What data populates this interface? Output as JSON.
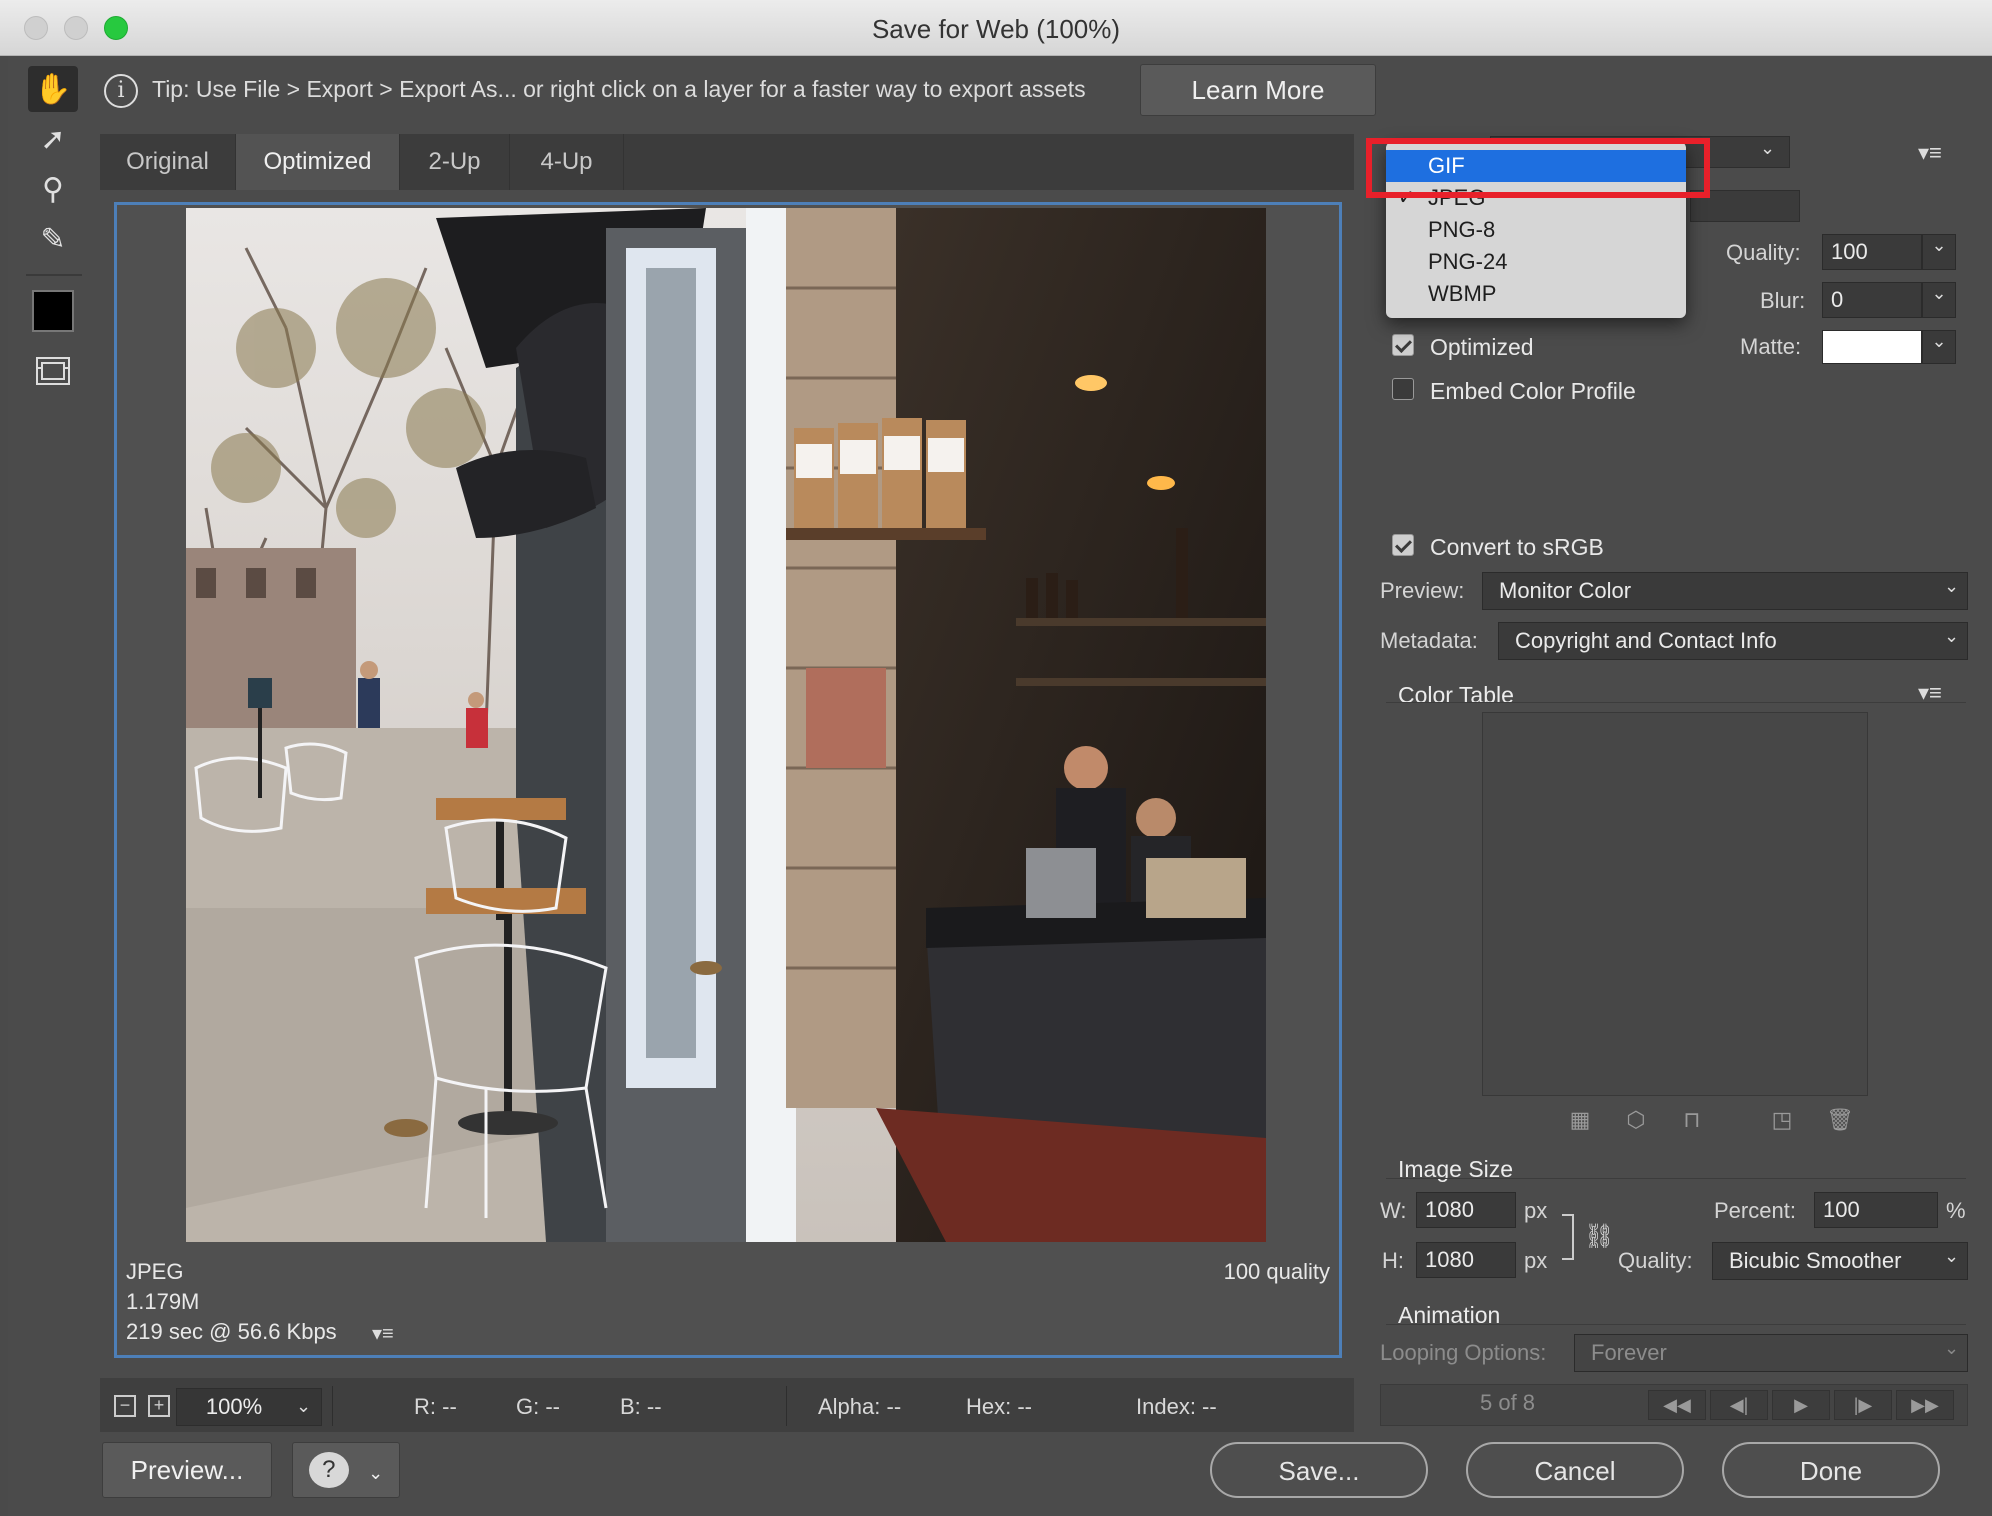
{
  "window": {
    "title": "Save for Web (100%)"
  },
  "tools": {
    "items": [
      {
        "name": "hand-tool",
        "glyph": "✋",
        "icon": "hand-icon"
      },
      {
        "name": "slice-select-tool",
        "glyph": "➚",
        "icon": "slice-select-icon"
      },
      {
        "name": "zoom-tool",
        "glyph": "⚲",
        "icon": "magnifier-icon"
      },
      {
        "name": "eyedropper-tool",
        "glyph": "✎",
        "icon": "eyedropper-icon"
      }
    ]
  },
  "tip": {
    "icon_glyph": "i",
    "text": "Tip: Use File > Export > Export As...  or right click on a layer for a faster way to export assets",
    "learn_more": "Learn More"
  },
  "tabs": [
    "Original",
    "Optimized",
    "2-Up",
    "4-Up"
  ],
  "active_tab": "Optimized",
  "preview_info": {
    "format": "JPEG",
    "size": "1.179M",
    "time": "219 sec @ 56.6 Kbps",
    "quality": "100 quality",
    "menu_glyph": "▾≡"
  },
  "status": {
    "zoom_minus": "−",
    "zoom_plus": "+",
    "zoom": "100%",
    "r": "R: --",
    "g": "G: --",
    "b": "B: --",
    "alpha": "Alpha: --",
    "hex": "Hex: --",
    "index": "Index: --"
  },
  "buttons": {
    "preview": "Preview...",
    "browser_glyph": "?",
    "save": "Save...",
    "cancel": "Cancel",
    "done": "Done"
  },
  "format_menu": {
    "items": [
      "GIF",
      "JPEG",
      "PNG-8",
      "PNG-24",
      "WBMP"
    ],
    "selected": "GIF",
    "checked": "JPEG"
  },
  "settings": {
    "quality_label": "Quality:",
    "quality": "100",
    "blur_label": "Blur:",
    "blur": "0",
    "matte_label": "Matte:",
    "matte_color": "#ffffff",
    "optimized": "Optimized",
    "optimized_checked": true,
    "embed_profile": "Embed Color Profile",
    "embed_checked": false,
    "convert_srgb": "Convert to sRGB",
    "convert_checked": true,
    "preview_label": "Preview:",
    "preview_value": "Monitor Color",
    "metadata_label": "Metadata:",
    "metadata_value": "Copyright and Contact Info"
  },
  "color_table": {
    "title": "Color Table"
  },
  "image_size": {
    "title": "Image Size",
    "w_label": "W:",
    "w": "1080",
    "h_label": "H:",
    "h": "1080",
    "unit": "px",
    "percent_label": "Percent:",
    "percent": "100",
    "percent_unit": "%",
    "quality_label": "Quality:",
    "quality_value": "Bicubic Smoother"
  },
  "animation": {
    "title": "Animation",
    "looping_label": "Looping Options:",
    "looping_value": "Forever",
    "frame": "5 of 8"
  }
}
